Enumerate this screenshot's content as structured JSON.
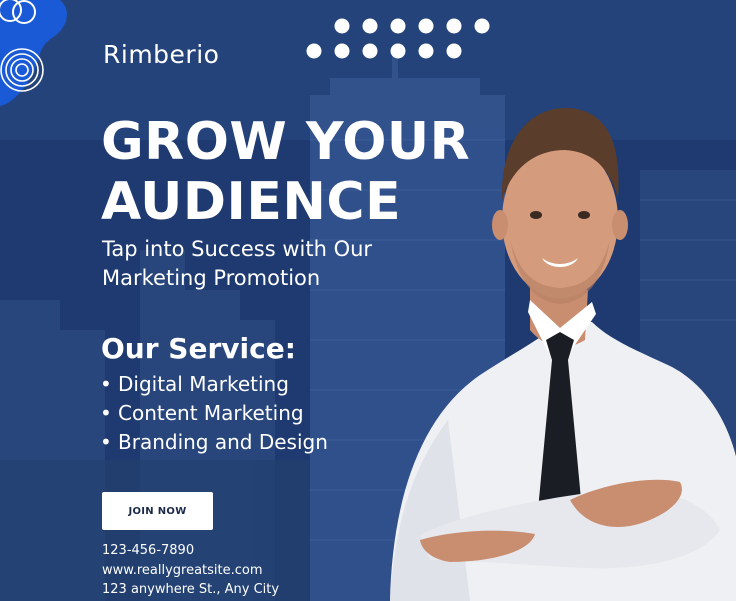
{
  "brand": {
    "name": "Rimberio"
  },
  "headline": {
    "line1": "GROW YOUR",
    "line2": "AUDIENCE"
  },
  "subhead": {
    "line1": "Tap into Success with Our",
    "line2": "Marketing Promotion"
  },
  "services": {
    "title": "Our Service:",
    "items": [
      "Digital Marketing",
      "Content Marketing",
      "Branding and Design"
    ]
  },
  "cta": {
    "label": "JOIN NOW"
  },
  "contact": {
    "phone": "123-456-7890",
    "website": "www.reallygreatsite.com",
    "address": "123 anywhere St., Any City"
  },
  "icons": {
    "brand_shape": "wave-circles-shape",
    "dots": "dot-grid-decoration",
    "background": "city-skyline-photo",
    "person": "businessman-photo"
  },
  "colors": {
    "background": "#1f3a70",
    "brand_blue": "#1a5ad6",
    "text": "#ffffff",
    "button_bg": "#ffffff",
    "button_text": "#1b2a48"
  }
}
